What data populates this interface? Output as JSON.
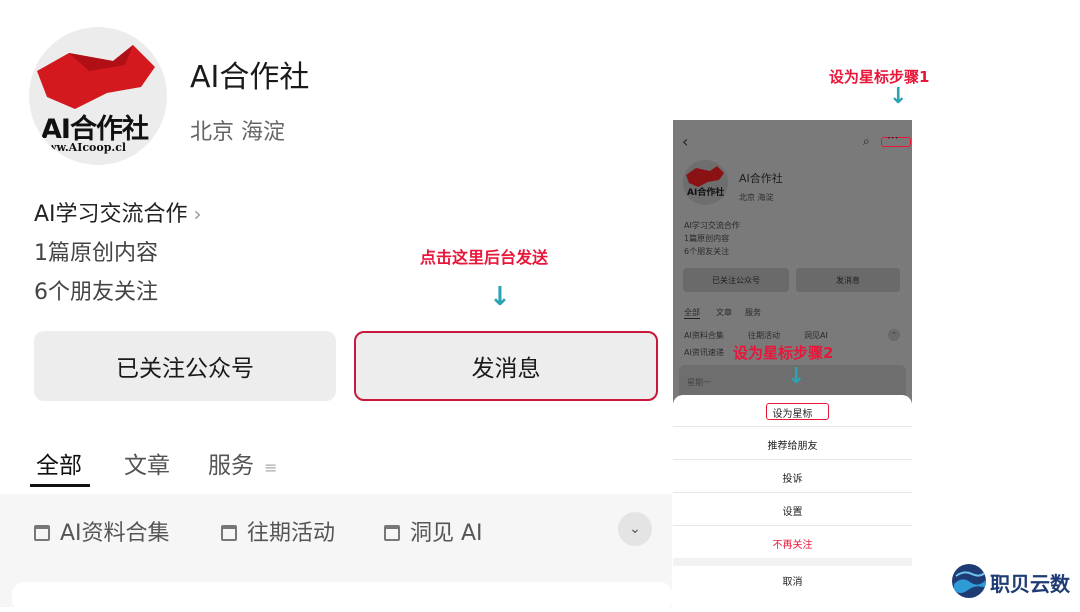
{
  "account": {
    "avatar_text": "AI合作社",
    "avatar_url": "ww.AIcoop.cl",
    "name": "AI合作社",
    "location": "北京 海淀",
    "category": "AI学习交流合作",
    "originals": "1篇原创内容",
    "followers": "6个朋友关注"
  },
  "buttons": {
    "follow": "已关注公众号",
    "message": "发消息"
  },
  "annotations": {
    "send_hint": "点击这里后台发送",
    "star_step1": "设为星标步骤1",
    "star_step2": "设为星标步骤2"
  },
  "tabs": [
    "全部",
    "文章",
    "服务"
  ],
  "collections": [
    "AI资料合集",
    "往期活动",
    "洞见 AI"
  ],
  "phone": {
    "name": "AI合作社",
    "location": "北京 海淀",
    "category": "AI学习交流合作",
    "originals": "1篇原创内容",
    "followers": "6个朋友关注",
    "follow": "已关注公众号",
    "message": "发消息",
    "tabs": [
      "全部",
      "文章",
      "服务"
    ],
    "collections": [
      "AI资料合集",
      "往期活动",
      "洞见AI"
    ],
    "collection_cut": "AI资讯速递",
    "weekday": "星期一",
    "menu": [
      "设为星标",
      "推荐给朋友",
      "投诉",
      "设置",
      "不再关注",
      "取消"
    ]
  },
  "watermark": "职贝云数",
  "colors": {
    "annotation": "#e8173a",
    "arrow": "#2aa3b4",
    "logo_red": "#d3181e",
    "brand_blue": "#1e3b74"
  }
}
